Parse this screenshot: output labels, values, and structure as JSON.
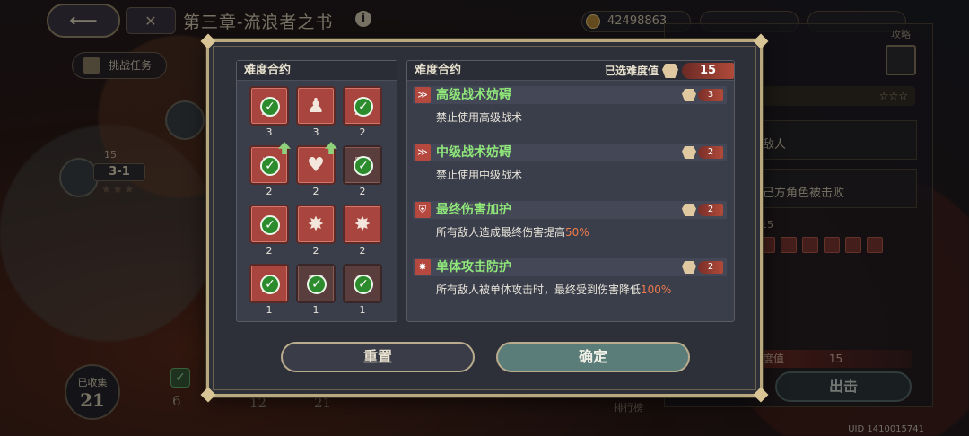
{
  "header": {
    "back_icon": "back-arrow-icon",
    "menu_icon": "grid-icon",
    "chapter_title": "第三章-流浪者之书",
    "info_icon": "i",
    "coins": "42498863",
    "res1": "",
    "res2": ""
  },
  "map": {
    "task_tab": "挑战任务",
    "stage_difficulty": "15",
    "stage_label": "3-1",
    "collect_label": "已收集",
    "collect_count": "21",
    "path_numbers": [
      "6",
      "12",
      "21"
    ]
  },
  "side_panel": {
    "guide_label": "攻略",
    "enemy_text": "敌人",
    "defeat_text": "己方角色被击败",
    "difficulty_small": "15",
    "difficulty_label": "度值",
    "difficulty_bar_value": "15",
    "start_button": "出击",
    "rank_label": "排行榜",
    "uid": "UID 1410015741"
  },
  "modal": {
    "left_title": "难度合约",
    "right_title": "难度合约",
    "selected_label": "已选难度值",
    "selected_total": "15",
    "contracts": [
      {
        "glyph": "▲",
        "level": "3",
        "checked": true,
        "dark": false,
        "arrow": false
      },
      {
        "glyph": "♟",
        "level": "3",
        "checked": false,
        "dark": false,
        "arrow": false
      },
      {
        "glyph": "▲",
        "level": "2",
        "checked": true,
        "dark": false,
        "arrow": false
      },
      {
        "glyph": "⚔",
        "level": "2",
        "checked": true,
        "dark": false,
        "arrow": true
      },
      {
        "glyph": "♥",
        "level": "2",
        "checked": false,
        "dark": false,
        "arrow": true
      },
      {
        "glyph": "⛨",
        "level": "2",
        "checked": true,
        "dark": true,
        "arrow": false
      },
      {
        "glyph": "✸",
        "level": "2",
        "checked": true,
        "dark": false,
        "arrow": false
      },
      {
        "glyph": "✸",
        "level": "2",
        "checked": false,
        "dark": false,
        "arrow": false
      },
      {
        "glyph": "✸",
        "level": "2",
        "checked": false,
        "dark": false,
        "arrow": false
      },
      {
        "glyph": "▲",
        "level": "1",
        "checked": true,
        "dark": false,
        "arrow": false
      },
      {
        "glyph": "⛨",
        "level": "1",
        "checked": true,
        "dark": true,
        "arrow": false
      },
      {
        "glyph": "♥",
        "level": "1",
        "checked": true,
        "dark": true,
        "arrow": false
      }
    ],
    "items": [
      {
        "icon": "≫",
        "name": "高级战术妨碍",
        "cost": "3",
        "desc": "禁止使用高级战术",
        "highlight": ""
      },
      {
        "icon": "≫",
        "name": "中级战术妨碍",
        "cost": "2",
        "desc": "禁止使用中级战术",
        "highlight": ""
      },
      {
        "icon": "⛨",
        "name": "最终伤害加护",
        "cost": "2",
        "desc": "所有敌人造成最终伤害提高",
        "highlight": "50%"
      },
      {
        "icon": "✸",
        "name": "单体攻击防护",
        "cost": "2",
        "desc": "所有敌人被单体攻击时，最终受到伤害降低",
        "highlight": "100%"
      }
    ],
    "reset_button": "重置",
    "confirm_button": "确定"
  }
}
